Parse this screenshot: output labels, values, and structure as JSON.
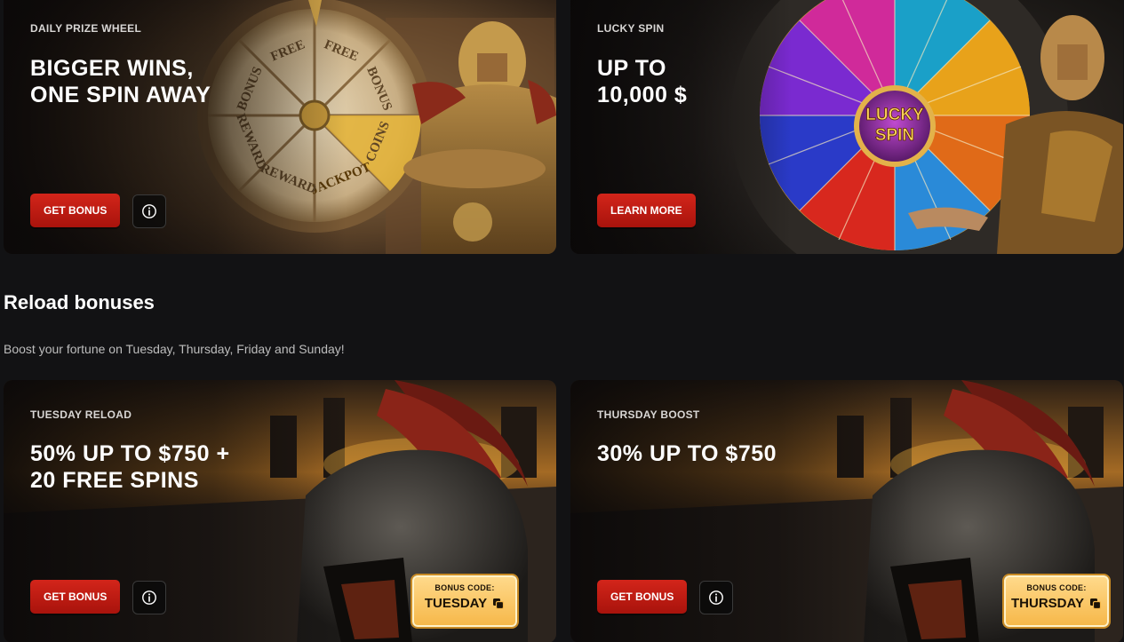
{
  "promos": [
    {
      "label": "DAILY PRIZE WHEEL",
      "title_lines": [
        "BIGGER WINS,",
        "ONE SPIN AWAY"
      ],
      "button": "GET BONUS",
      "wheel_words": [
        "FREE",
        "BONUS",
        "COINS",
        "JACKPOT",
        "REWARD",
        "REWARD",
        "BONUS",
        "FREE"
      ]
    },
    {
      "label": "LUCKY SPIN",
      "title_lines": [
        "UP TO",
        "10,000 $"
      ],
      "button": "LEARN MORE",
      "wheel_center": [
        "LUCKY",
        "SPIN"
      ]
    }
  ],
  "reload": {
    "title": "Reload bonuses",
    "subtitle": "Boost your fortune on Tuesday, Thursday, Friday and Sunday!"
  },
  "reload_cards": [
    {
      "label": "TUESDAY RELOAD",
      "title_lines": [
        "50% UP TO $750 +",
        "20 FREE SPINS"
      ],
      "button": "GET BONUS",
      "code_caption": "BONUS CODE:",
      "code": "TUESDAY"
    },
    {
      "label": "THURSDAY BOOST",
      "title_lines": [
        "30% UP TO $750"
      ],
      "button": "GET BONUS",
      "code_caption": "BONUS CODE:",
      "code": "THURSDAY"
    }
  ],
  "icons": {
    "info": "info-icon",
    "copy": "copy-icon"
  },
  "colors": {
    "page_bg": "#121214",
    "button_red": "#c31d14",
    "code_gold": "#f6b84a"
  }
}
